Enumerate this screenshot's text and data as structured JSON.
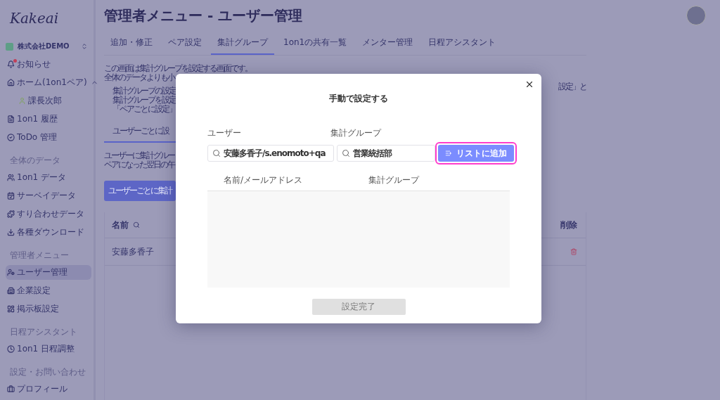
{
  "logo": "Kakeai",
  "company": "株式会社DEMO",
  "sidebar": [
    {
      "kind": "item",
      "label": "お知らせ",
      "selected": false,
      "notify": true
    },
    {
      "kind": "item",
      "label": "ホーム(1on1ペア)",
      "selected": false,
      "expanded": true,
      "children": [
        {
          "label": "課長次郎",
          "selected": false
        }
      ]
    },
    {
      "kind": "item",
      "label": "1on1 履歴",
      "selected": false
    },
    {
      "kind": "item",
      "label": "ToDo 管理",
      "selected": false
    },
    {
      "kind": "section",
      "label": "全体のデータ"
    },
    {
      "kind": "item",
      "label": "1on1 データ",
      "selected": false
    },
    {
      "kind": "item",
      "label": "サーベイデータ",
      "selected": false
    },
    {
      "kind": "item",
      "label": "すり合わせデータ",
      "selected": false
    },
    {
      "kind": "item",
      "label": "各種ダウンロード",
      "selected": false
    },
    {
      "kind": "section",
      "label": "管理者メニュー"
    },
    {
      "kind": "item",
      "label": "ユーザー管理",
      "selected": true
    },
    {
      "kind": "item",
      "label": "企業設定",
      "selected": false
    },
    {
      "kind": "item",
      "label": "掲示板設定",
      "selected": false
    },
    {
      "kind": "section",
      "label": "日程アシスタント"
    },
    {
      "kind": "item",
      "label": "1on1 日程調整",
      "selected": false
    },
    {
      "kind": "section",
      "label": "設定・お問い合わせ"
    },
    {
      "kind": "item",
      "label": "プロフィール",
      "selected": false
    }
  ],
  "page_title": "管理者メニュー - ユーザー管理",
  "tabs": [
    {
      "label": "追加・修正",
      "selected": false
    },
    {
      "label": "ペア設定",
      "selected": false
    },
    {
      "label": "集計グループ",
      "selected": true
    },
    {
      "label": "1on1の共有一覧",
      "selected": false
    },
    {
      "label": "メンター管理",
      "selected": false
    },
    {
      "label": "日程アシスタント",
      "selected": false
    }
  ],
  "intro": [
    "この画面は集計グループを設定する画面です。",
    "全体のデータよりも小"
  ],
  "notes": [
    "集計グループの設定",
    "集計グループを設定",
    "「ペアごとに設定」"
  ],
  "notes_right": "設定」と",
  "subtab": {
    "label": "ユーザーごとに設",
    "selected": true
  },
  "description": [
    "ユーザーに集計グルー",
    "ペアになった翌日の午"
  ],
  "action_button": "ユーザーごとに集計",
  "table": {
    "columns": [
      "名前",
      "削除"
    ],
    "rows": [
      {
        "name": "安藤多香子"
      }
    ]
  },
  "dialog": {
    "title": "手動で設定する",
    "user_label": "ユーザー",
    "user_value": "安藤多香子/s.enomoto+qa",
    "group_label": "集計グループ",
    "group_value": "営業統括部",
    "add_button": "リストに追加",
    "columns": [
      "名前/メールアドレス",
      "集計グループ"
    ],
    "done_button": {
      "label": "設定完了",
      "disabled": true
    }
  }
}
